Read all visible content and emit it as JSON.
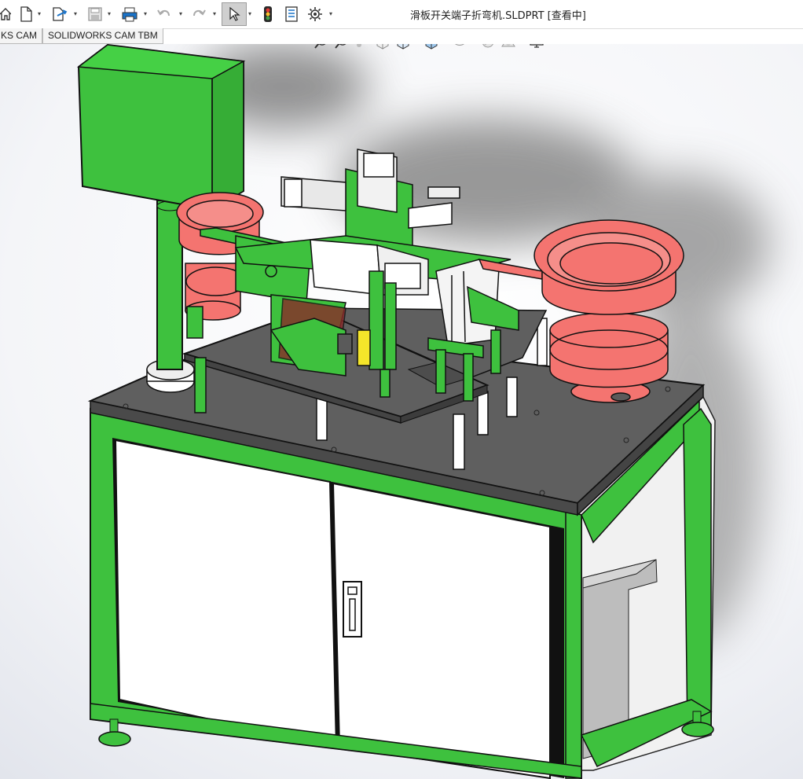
{
  "window": {
    "title": "滑板开关端子折弯机.SLDPRT [查看中]"
  },
  "toolbar": {
    "icons": [
      "home-icon",
      "new-document-icon",
      "open-icon",
      "save-icon",
      "print-icon",
      "undo-icon",
      "redo-icon",
      "select-icon",
      "rebuild-icon",
      "file-properties-icon",
      "options-icon"
    ]
  },
  "tabs": [
    {
      "label": "KS CAM"
    },
    {
      "label": "SOLIDWORKS CAM TBM"
    }
  ],
  "heads_up": {
    "icons": [
      "zoom-to-fit-icon",
      "zoom-area-icon",
      "previous-view-icon",
      "section-view-icon",
      "view-orientation-icon",
      "display-style-icon",
      "hide-show-icon",
      "edit-appearance-icon",
      "apply-scene-icon",
      "view-settings-icon"
    ]
  },
  "colors": {
    "frame_green": "#3ec13e",
    "plate_gray": "#5f5f5f",
    "bowl_red": "#f47470",
    "panel_white": "#ffffff"
  }
}
